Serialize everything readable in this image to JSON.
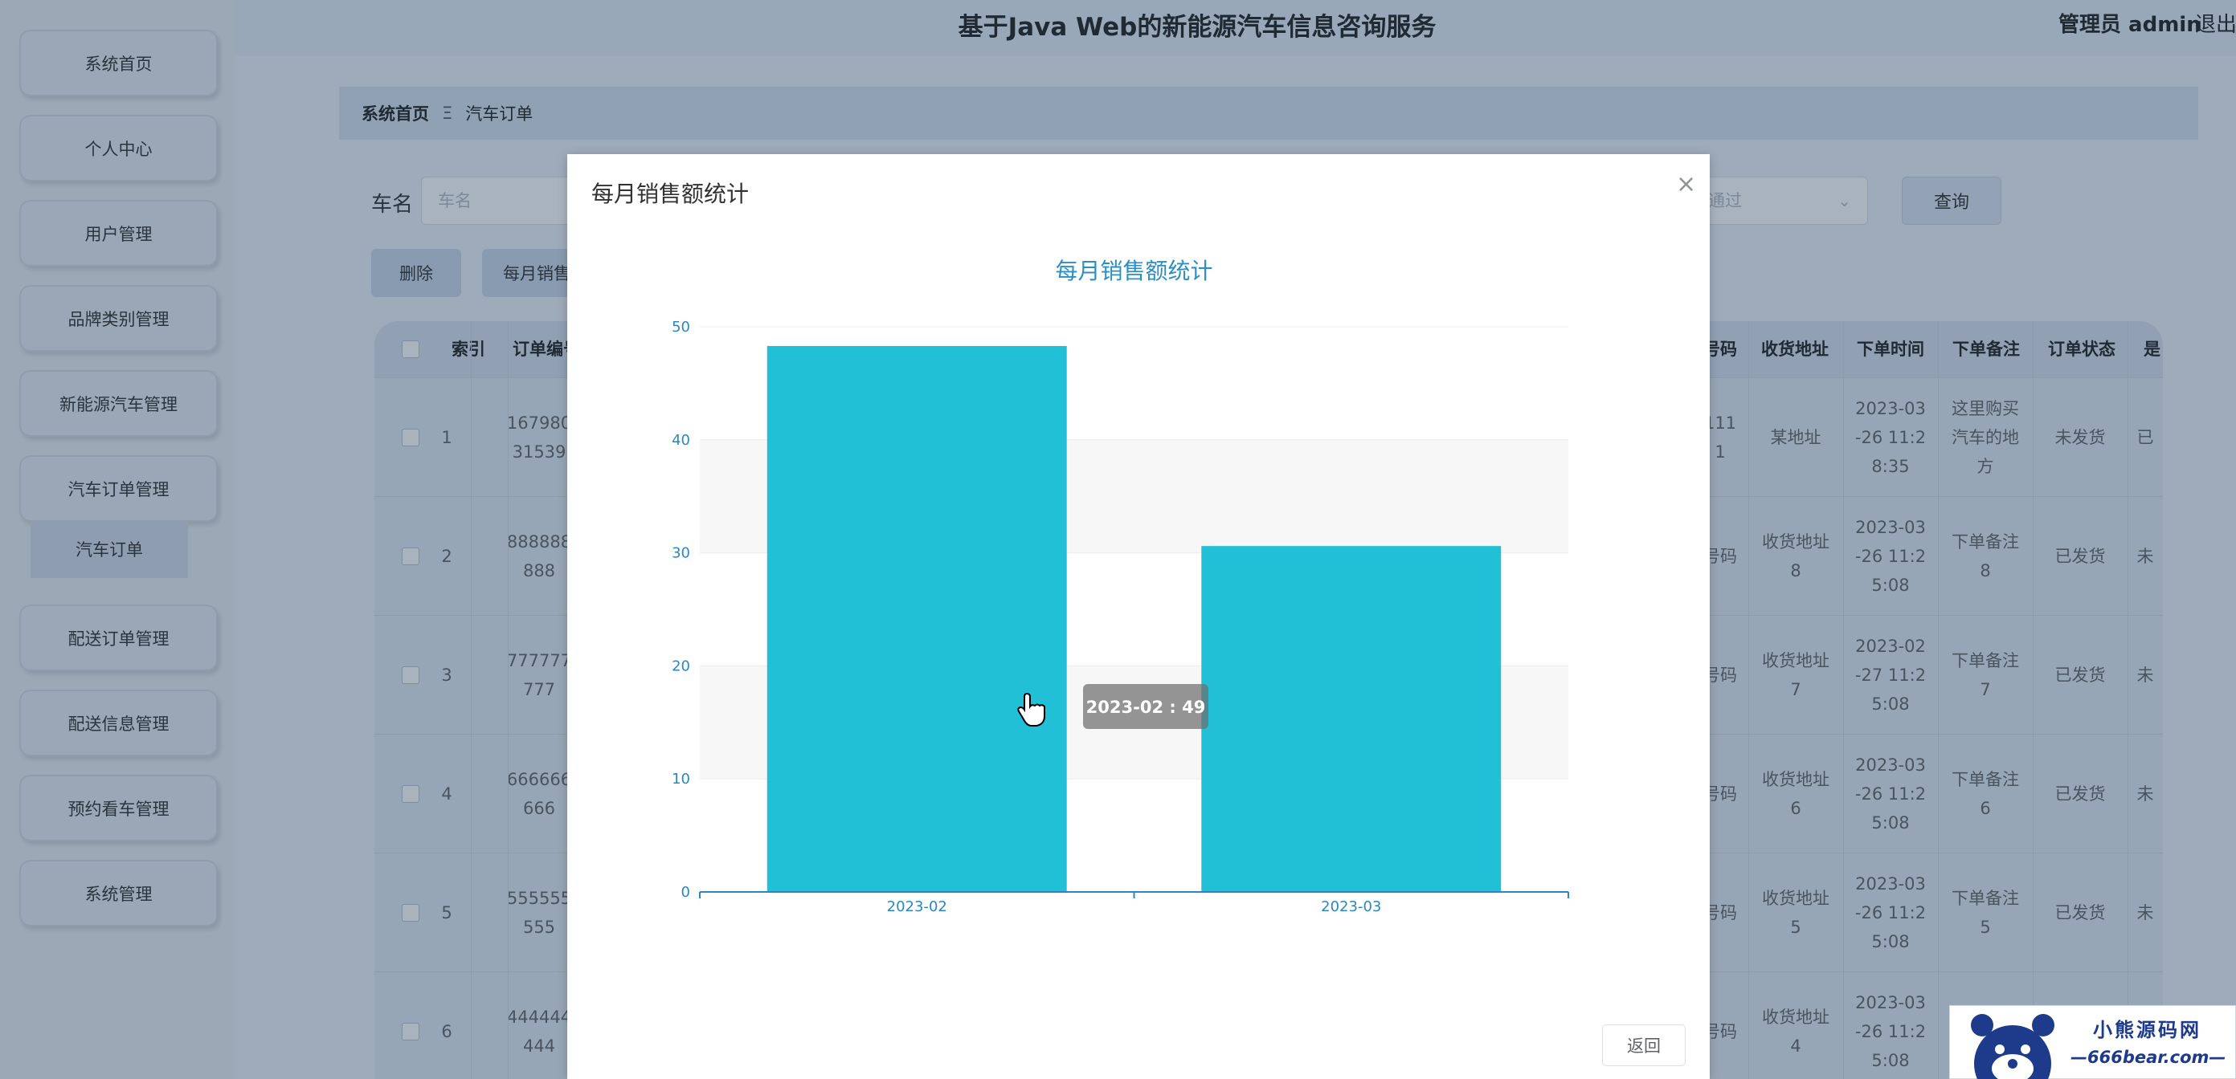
{
  "app": {
    "title": "基于Java Web的新能源汽车信息咨询服务",
    "admin": "管理员 admin",
    "logout": "退出登录"
  },
  "sidebar": {
    "items": [
      "系统首页",
      "个人中心",
      "用户管理",
      "品牌类别管理",
      "新能源汽车管理",
      "汽车订单管理",
      "配送订单管理",
      "配送信息管理",
      "预约看车管理",
      "系统管理"
    ],
    "sub_item": "汽车订单"
  },
  "breadcrumb": {
    "home": "系统首页",
    "sep": "Ξ",
    "current": "汽车订单"
  },
  "filters": {
    "car_name_label": "车名",
    "car_name_placeholder": "车名",
    "status_placeholder": "通过",
    "query_label": "查询"
  },
  "actions": {
    "delete_label": "删除",
    "stats_label": "每月销售额统计"
  },
  "table": {
    "headers": [
      "索引",
      "订单编号",
      "号码",
      "收货地址",
      "下单时间",
      "下单备注",
      "订单状态",
      "是"
    ],
    "rows": [
      {
        "index": "1",
        "order_no": [
          "167980",
          "31539"
        ],
        "phone": [
          "111",
          "1"
        ],
        "address": "某地址",
        "time": [
          "2023-03",
          "-26 11:2",
          "8:35"
        ],
        "note": [
          "这里购买",
          "汽车的地",
          "方"
        ],
        "status": "未发货",
        "extra": "已"
      },
      {
        "index": "2",
        "order_no": [
          "888888",
          "888"
        ],
        "phone": [
          "号码",
          ""
        ],
        "address": "收货地址\n8",
        "time": [
          "2023-03",
          "-26 11:2",
          "5:08"
        ],
        "note": [
          "下单备注",
          "8"
        ],
        "status": "已发货",
        "extra": "未"
      },
      {
        "index": "3",
        "order_no": [
          "777777",
          "777"
        ],
        "phone": [
          "号码",
          ""
        ],
        "address": "收货地址\n7",
        "time": [
          "2023-02",
          "-27 11:2",
          "5:08"
        ],
        "note": [
          "下单备注",
          "7"
        ],
        "status": "已发货",
        "extra": "未"
      },
      {
        "index": "4",
        "order_no": [
          "666666",
          "666"
        ],
        "phone": [
          "号码",
          ""
        ],
        "address": "收货地址\n6",
        "time": [
          "2023-03",
          "-26 11:2",
          "5:08"
        ],
        "note": [
          "下单备注",
          "6"
        ],
        "status": "已发货",
        "extra": "未"
      },
      {
        "index": "5",
        "order_no": [
          "555555",
          "555"
        ],
        "phone": [
          "号码",
          ""
        ],
        "address": "收货地址\n5",
        "time": [
          "2023-03",
          "-26 11:2",
          "5:08"
        ],
        "note": [
          "下单备注",
          "5"
        ],
        "status": "已发货",
        "extra": "未"
      },
      {
        "index": "6",
        "order_no": [
          "444444",
          "444"
        ],
        "phone": [
          "号码",
          ""
        ],
        "address": "收货地址\n4",
        "time": [
          "2023-03",
          "-26 11:2",
          "5:08"
        ],
        "note": [
          "",
          ""
        ],
        "status": "",
        "extra": ""
      }
    ]
  },
  "dialog": {
    "title": "每月销售额统计",
    "close": "×",
    "back_label": "返回",
    "tooltip": "2023-02 : 49"
  },
  "chart_data": {
    "type": "bar",
    "title": "每月销售额统计",
    "categories": [
      "2023-02",
      "2023-03"
    ],
    "values": [
      48.3,
      30.6
    ],
    "ylim": [
      0,
      50
    ],
    "yticks": [
      0,
      10,
      20,
      30,
      40,
      50
    ],
    "xlabel": "",
    "ylabel": "",
    "grid": true,
    "bar_color": "#22c0d6",
    "title_color": "#2c8fc4",
    "axis_color": "#2a88c0"
  },
  "watermark": {
    "name": "小熊源码网",
    "url": "—666bear.com—"
  }
}
